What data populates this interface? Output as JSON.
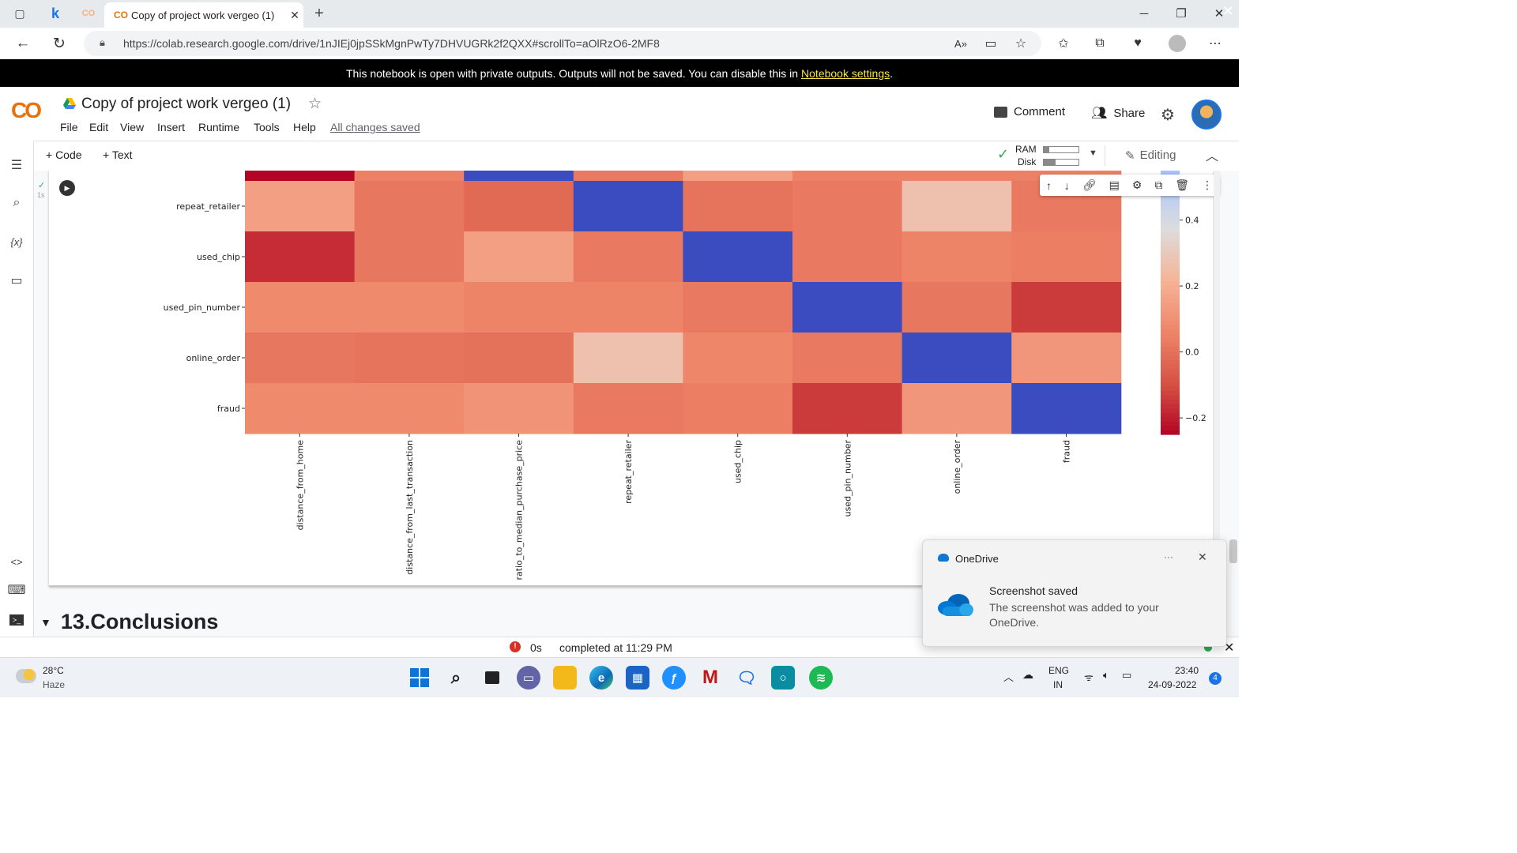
{
  "browser": {
    "tab_title": "Copy of project work vergeo (1)",
    "tab_logo": "CO",
    "pinned_tab_letter": "k",
    "url": "https://colab.research.google.com/drive/1nJIEj0jpSSkMgnPwTy7DHVUGRk2f2QXX#scrollTo=aOlRzO6-2MF8"
  },
  "banner": {
    "message": "This notebook is open with private outputs. Outputs will not be saved. You can disable this in",
    "link": "Notebook settings",
    "end": "."
  },
  "header": {
    "logo": "CO",
    "title": "Copy of project work vergeo (1)",
    "menu": [
      "File",
      "Edit",
      "View",
      "Insert",
      "Runtime",
      "Tools",
      "Help"
    ],
    "saved_status": "All changes saved",
    "comment": "Comment",
    "share": "Share"
  },
  "toolbar": {
    "add_code": "+ Code",
    "add_text": "+ Text",
    "ram_label": "RAM",
    "disk_label": "Disk",
    "ram_usage": 0.15,
    "disk_usage": 0.35,
    "editing": "Editing"
  },
  "cell": {
    "exec_time": "1s"
  },
  "chart_data": {
    "type": "heatmap",
    "title": "",
    "row_labels_visible": [
      "repeat_retailer",
      "used_chip",
      "used_pin_number",
      "online_order",
      "fraud"
    ],
    "x_labels": [
      "distance_from_home",
      "distance_from_last_transaction",
      "ratio_to_median_purchase_price",
      "repeat_retailer",
      "used_chip",
      "used_pin_number",
      "online_order",
      "fraud"
    ],
    "top_partial_row": [
      -0.25,
      0.05,
      1.0,
      0.03,
      0.15,
      0.05,
      0.05,
      0.05
    ],
    "rows": [
      {
        "name": "repeat_retailer",
        "values": [
          0.15,
          0.02,
          -0.02,
          1.0,
          0.01,
          0.03,
          0.27,
          0.03
        ]
      },
      {
        "name": "used_chip",
        "values": [
          -0.17,
          0.02,
          0.15,
          0.03,
          1.0,
          0.03,
          0.06,
          0.04
        ]
      },
      {
        "name": "used_pin_number",
        "values": [
          0.08,
          0.08,
          0.06,
          0.06,
          0.03,
          1.0,
          0.02,
          -0.14
        ]
      },
      {
        "name": "online_order",
        "values": [
          0.02,
          0.01,
          0.0,
          0.27,
          0.07,
          0.03,
          1.0,
          0.12
        ]
      },
      {
        "name": "fraud",
        "values": [
          0.08,
          0.08,
          0.11,
          0.03,
          0.04,
          -0.14,
          0.12,
          1.0
        ]
      }
    ],
    "colormap": "coolwarm_r",
    "vmin": -0.25,
    "vmax": 1.0,
    "colorbar_ticks": [
      0.4,
      0.2,
      0.0,
      -0.2
    ],
    "colorbar_tick_labels": [
      "0.4",
      "0.2",
      "0.0",
      "−0.2"
    ]
  },
  "section": {
    "heading": "13.Conclusions"
  },
  "status": {
    "error_badge": "!",
    "elapsed": "0s",
    "completed": "completed at 11:29 PM"
  },
  "toast": {
    "app": "OneDrive",
    "title": "Screenshot saved",
    "body": "The screenshot was added to your OneDrive.",
    "more": "···"
  },
  "taskbar": {
    "temperature": "28°C",
    "weather": "Haze",
    "language": "ENG",
    "region": "IN",
    "time": "23:40",
    "date": "24-09-2022",
    "notifications": "4"
  },
  "colors": {
    "blue": "#3b4cc0",
    "red": "#b40426",
    "banner_link": "#f9e547",
    "colab_orange": "#e8710a"
  }
}
